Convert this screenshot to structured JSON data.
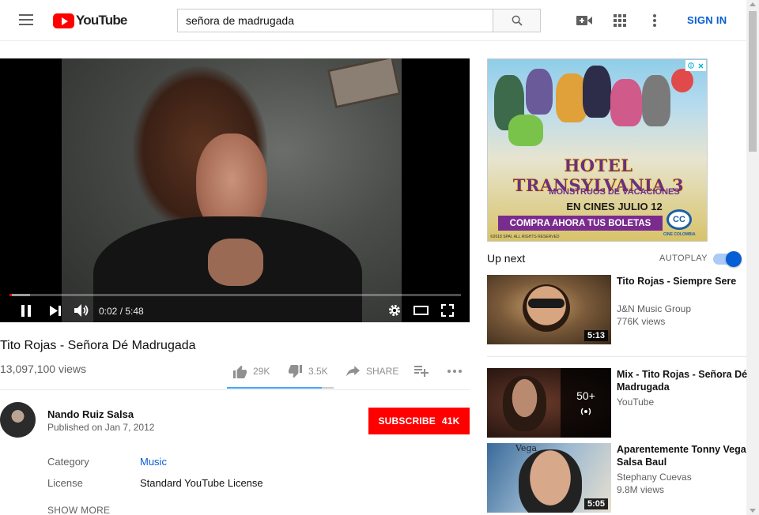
{
  "header": {
    "logo_text": "YouTube",
    "search_value": "señora de madrugada",
    "signin_label": "SIGN IN",
    "icons": [
      "menu-icon",
      "search-icon",
      "create-video-icon",
      "apps-icon",
      "more-vert-icon"
    ]
  },
  "player": {
    "time": "0:02 / 5:48",
    "progress_played": 0.006,
    "progress_loaded": 0.045,
    "icons": [
      "pause-icon",
      "next-icon",
      "volume-icon",
      "settings-icon",
      "theater-icon",
      "fullscreen-icon"
    ]
  },
  "video": {
    "title": "Tito Rojas - Señora Dé Madrugada",
    "views": "13,097,100 views",
    "likes": "29K",
    "dislikes": "3.5K",
    "share_label": "SHARE",
    "like_ratio": 0.89
  },
  "channel": {
    "name": "Nando Ruiz Salsa",
    "published": "Published on Jan 7, 2012",
    "subscribe_label": "SUBSCRIBE",
    "subscriber_count": "41K"
  },
  "metadata": {
    "category_label": "Category",
    "category_value": "Music",
    "license_label": "License",
    "license_value": "Standard YouTube License",
    "show_more": "SHOW MORE"
  },
  "ad": {
    "title": "HOTEL TRANSYLVANIA 3",
    "subtitle": "MONSTRUOS DE VACACIONES",
    "release": "EN CINES JULIO 12",
    "cta": "COMPRA AHORA TUS BOLETAS",
    "cinema_logo": "CC",
    "cinema_name": "CINE COLOMBIA",
    "legal": "©2018 SPAI. ALL RIGHTS RESERVED"
  },
  "sidebar": {
    "upnext_label": "Up next",
    "autoplay_label": "AUTOPLAY",
    "autoplay_on": true,
    "recommendations": [
      {
        "title": "Tito Rojas - Siempre Sere",
        "channel": "J&N Music Group",
        "views": "776K views",
        "duration": "5:13"
      },
      {
        "title": "Mix - Tito Rojas - Señora Dé Madrugada",
        "channel": "YouTube",
        "views": "",
        "mix_count": "50+"
      },
      {
        "title": "Aparentemente Tonny Vega Salsa Baul",
        "channel": "Stephany Cuevas",
        "views": "9.8M views",
        "duration": "5:05",
        "thumb_caption": "Vega"
      }
    ]
  }
}
